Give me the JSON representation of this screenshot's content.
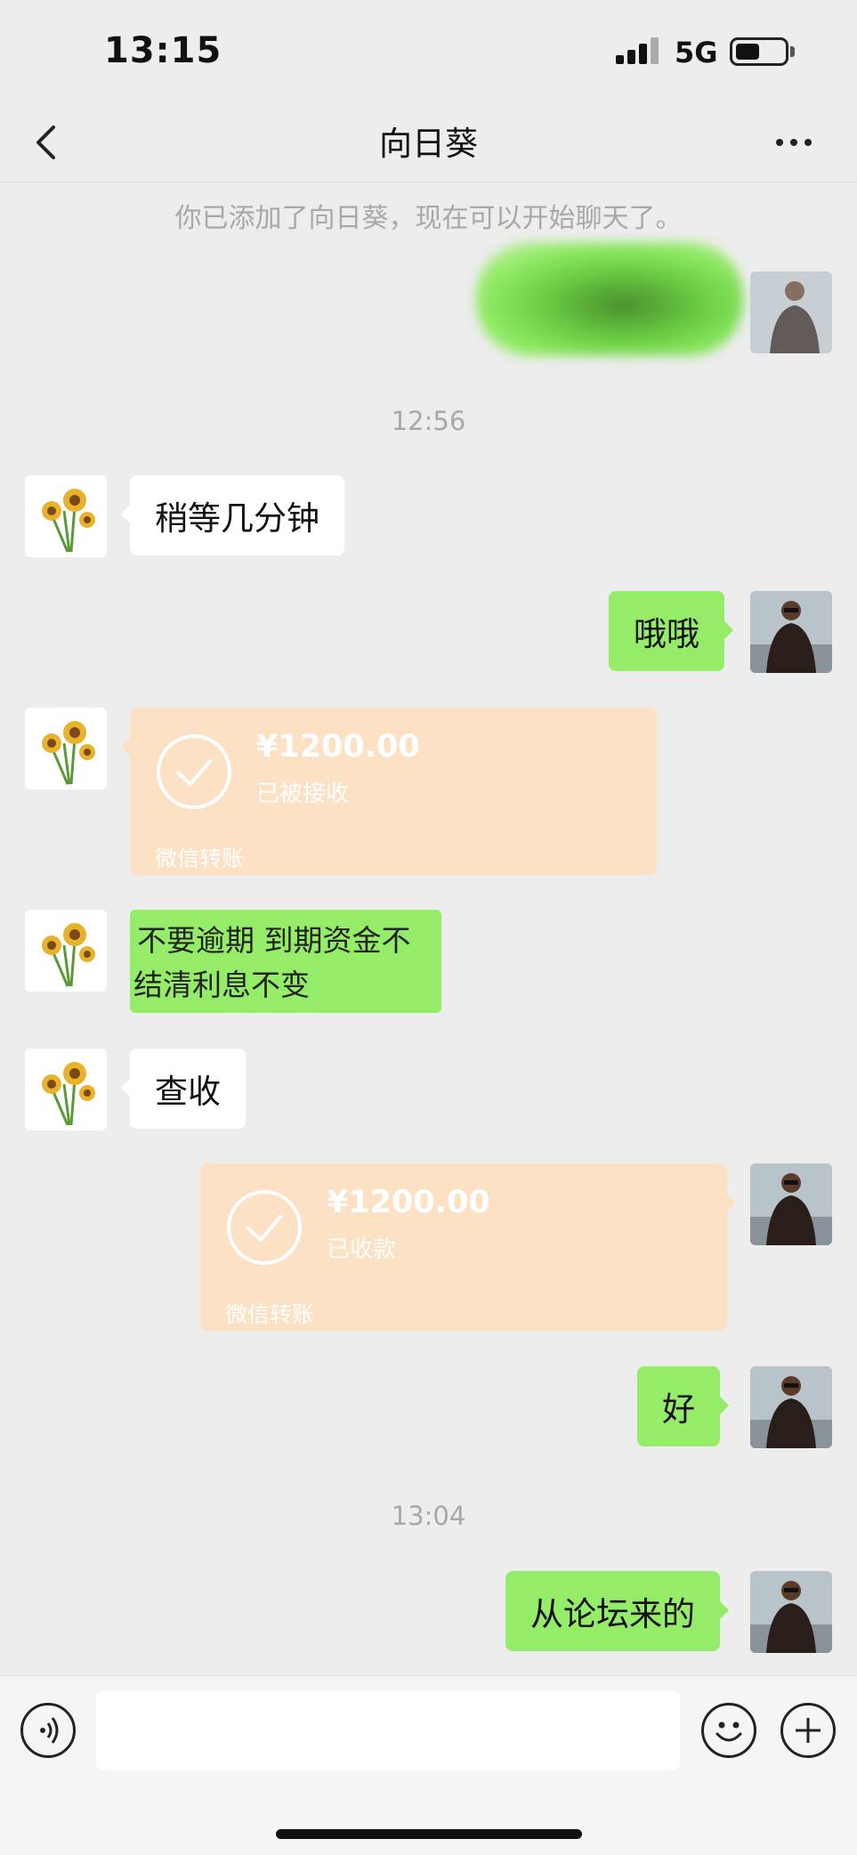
{
  "status_bar": {
    "time": "13:15",
    "network": "5G"
  },
  "header": {
    "title": "向日葵",
    "back_icon": "chevron-left-icon",
    "more_icon": "ellipsis-icon"
  },
  "system_note": "你已添加了向日葵，现在可以开始聊天了。",
  "timestamps": [
    "12:56",
    "13:04"
  ],
  "messages": [
    {
      "from": "contact",
      "text": "稍等几分钟"
    },
    {
      "from": "me",
      "text": "哦哦"
    },
    {
      "from": "contact",
      "type": "transfer",
      "amount": "¥1200.00",
      "status": "已被接收",
      "footer": "微信转账"
    },
    {
      "from": "contact",
      "type": "notice",
      "lines": [
        "不要逾期 到期资金不",
        "结清利息不变"
      ]
    },
    {
      "from": "contact",
      "text": "查收"
    },
    {
      "from": "me",
      "type": "transfer",
      "amount": "¥1200.00",
      "status": "已收款",
      "footer": "微信转账"
    },
    {
      "from": "me",
      "text": "好"
    },
    {
      "from": "me",
      "text": "从论坛来的"
    }
  ],
  "input_bar": {
    "voice_icon": "voice-icon",
    "emoji_icon": "emoji-icon",
    "plus_icon": "plus-icon",
    "message_placeholder": ""
  },
  "colors": {
    "background": "#ededed",
    "outgoing_bubble": "#95ec69",
    "incoming_bubble": "#ffffff",
    "transfer_card": "#fce1c4",
    "muted_text": "#a8a8a8"
  }
}
